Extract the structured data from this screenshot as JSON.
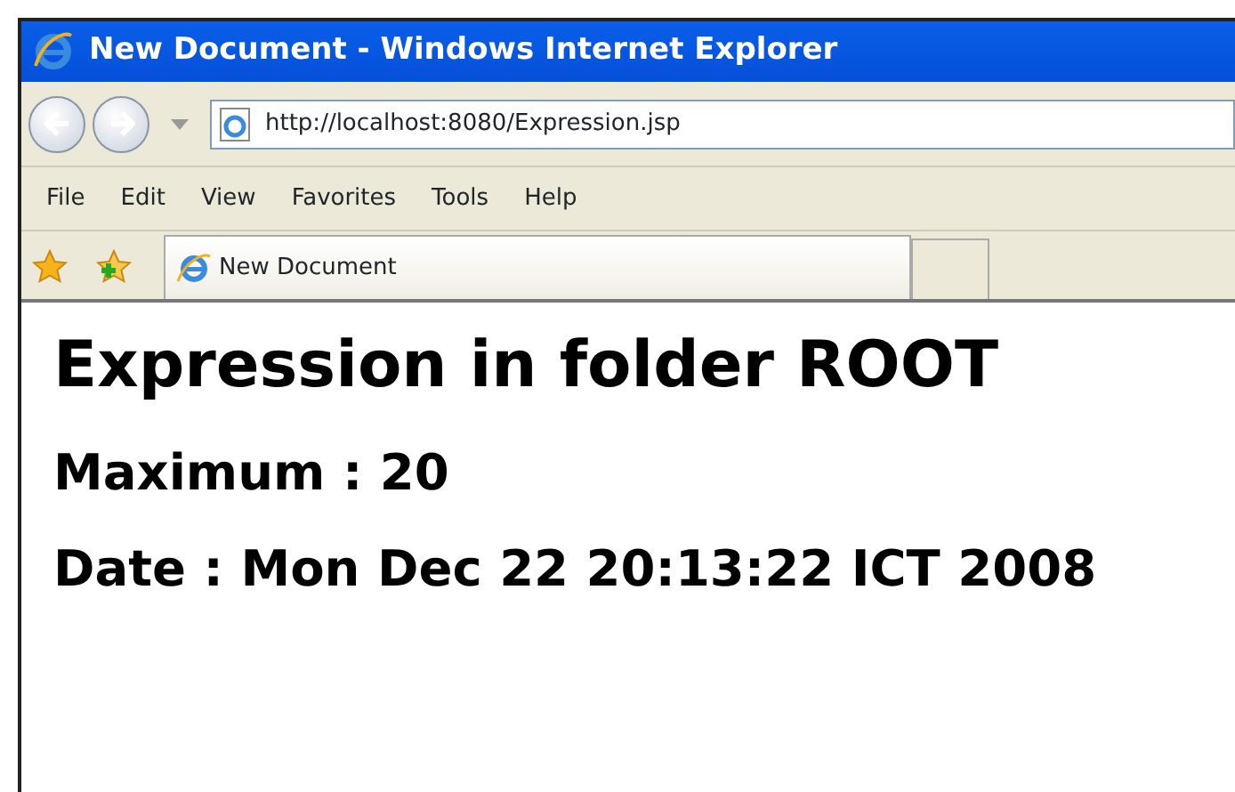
{
  "window": {
    "title": "New Document - Windows Internet Explorer"
  },
  "address_bar": {
    "url": "http://localhost:8080/Expression.jsp"
  },
  "menu": [
    "File",
    "Edit",
    "View",
    "Favorites",
    "Tools",
    "Help"
  ],
  "tabs": [
    {
      "label": "New Document",
      "selected": true
    }
  ],
  "page": {
    "heading": "Expression in folder ROOT",
    "lines": [
      "Maximum : 20",
      "Date : Mon Dec 22 20:13:22 ICT 2008"
    ]
  }
}
